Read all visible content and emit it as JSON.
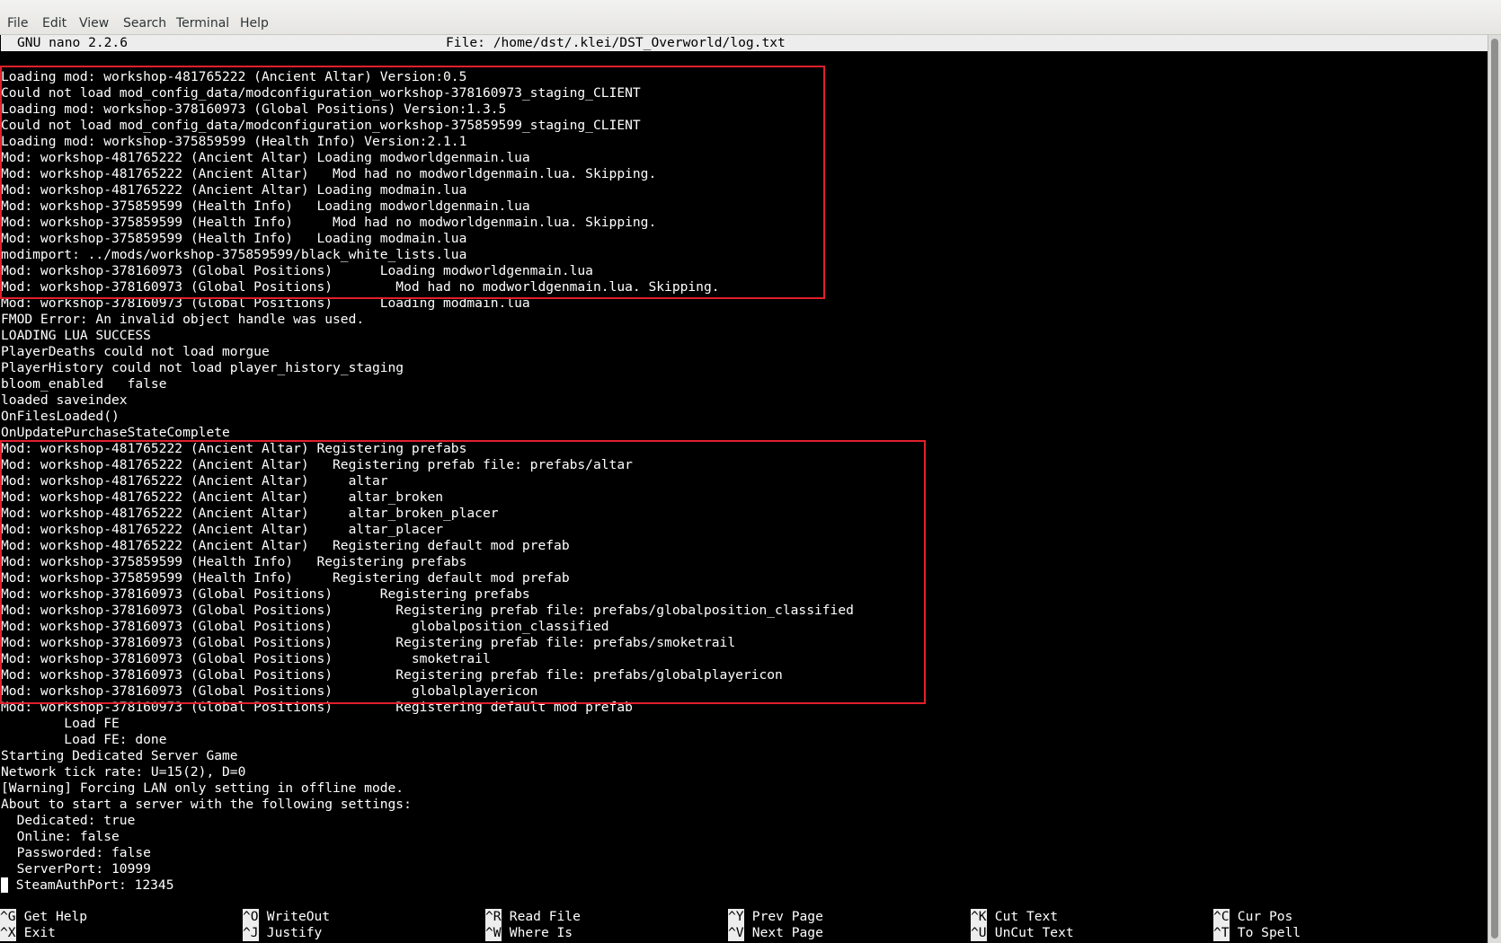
{
  "menu": [
    "File",
    "Edit",
    "View",
    "Search",
    "Terminal",
    "Help"
  ],
  "nano": {
    "version": "GNU nano 2.2.6",
    "file": "File: /home/dst/.klei/DST_Overworld/log.txt"
  },
  "log_lines": [
    "Loading mod: workshop-481765222 (Ancient Altar) Version:0.5",
    "Could not load mod_config_data/modconfiguration_workshop-378160973_staging_CLIENT",
    "Loading mod: workshop-378160973 (Global Positions) Version:1.3.5",
    "Could not load mod_config_data/modconfiguration_workshop-375859599_staging_CLIENT",
    "Loading mod: workshop-375859599 (Health Info) Version:2.1.1",
    "Mod: workshop-481765222 (Ancient Altar) Loading modworldgenmain.lua",
    "Mod: workshop-481765222 (Ancient Altar)   Mod had no modworldgenmain.lua. Skipping.",
    "Mod: workshop-481765222 (Ancient Altar) Loading modmain.lua",
    "Mod: workshop-375859599 (Health Info)   Loading modworldgenmain.lua",
    "Mod: workshop-375859599 (Health Info)     Mod had no modworldgenmain.lua. Skipping.",
    "Mod: workshop-375859599 (Health Info)   Loading modmain.lua",
    "modimport: ../mods/workshop-375859599/black_white_lists.lua",
    "Mod: workshop-378160973 (Global Positions)      Loading modworldgenmain.lua",
    "Mod: workshop-378160973 (Global Positions)        Mod had no modworldgenmain.lua. Skipping.",
    "Mod: workshop-378160973 (Global Positions)      Loading modmain.lua",
    "FMOD Error: An invalid object handle was used.",
    "LOADING LUA SUCCESS",
    "PlayerDeaths could not load morgue",
    "PlayerHistory could not load player_history_staging",
    "bloom_enabled   false",
    "loaded saveindex",
    "OnFilesLoaded()",
    "OnUpdatePurchaseStateComplete",
    "Mod: workshop-481765222 (Ancient Altar) Registering prefabs",
    "Mod: workshop-481765222 (Ancient Altar)   Registering prefab file: prefabs/altar",
    "Mod: workshop-481765222 (Ancient Altar)     altar",
    "Mod: workshop-481765222 (Ancient Altar)     altar_broken",
    "Mod: workshop-481765222 (Ancient Altar)     altar_broken_placer",
    "Mod: workshop-481765222 (Ancient Altar)     altar_placer",
    "Mod: workshop-481765222 (Ancient Altar)   Registering default mod prefab",
    "Mod: workshop-375859599 (Health Info)   Registering prefabs",
    "Mod: workshop-375859599 (Health Info)     Registering default mod prefab",
    "Mod: workshop-378160973 (Global Positions)      Registering prefabs",
    "Mod: workshop-378160973 (Global Positions)        Registering prefab file: prefabs/globalposition_classified",
    "Mod: workshop-378160973 (Global Positions)          globalposition_classified",
    "Mod: workshop-378160973 (Global Positions)        Registering prefab file: prefabs/smoketrail",
    "Mod: workshop-378160973 (Global Positions)          smoketrail",
    "Mod: workshop-378160973 (Global Positions)        Registering prefab file: prefabs/globalplayericon",
    "Mod: workshop-378160973 (Global Positions)          globalplayericon",
    "Mod: workshop-378160973 (Global Positions)        Registering default mod prefab",
    "        Load FE",
    "        Load FE: done",
    "Starting Dedicated Server Game",
    "Network tick rate: U=15(2), D=0",
    "[Warning] Forcing LAN only setting in offline mode.",
    "About to start a server with the following settings:",
    "  Dedicated: true",
    "  Online: false",
    "  Passworded: false",
    "  ServerPort: 10999",
    " SteamAuthPort: 12345"
  ],
  "shortcuts": [
    [
      {
        "key": "^G",
        "label": "Get Help"
      },
      {
        "key": "^X",
        "label": "Exit"
      }
    ],
    [
      {
        "key": "^O",
        "label": "WriteOut"
      },
      {
        "key": "^J",
        "label": "Justify"
      }
    ],
    [
      {
        "key": "^R",
        "label": "Read File"
      },
      {
        "key": "^W",
        "label": "Where Is"
      }
    ],
    [
      {
        "key": "^Y",
        "label": "Prev Page"
      },
      {
        "key": "^V",
        "label": "Next Page"
      }
    ],
    [
      {
        "key": "^K",
        "label": "Cut Text"
      },
      {
        "key": "^U",
        "label": "UnCut Text"
      }
    ],
    [
      {
        "key": "^C",
        "label": "Cur Pos"
      },
      {
        "key": "^T",
        "label": "To Spell"
      }
    ]
  ],
  "colors": {
    "highlight_box": "#e0202c",
    "terminal_bg": "#000000",
    "terminal_fg": "#ffffff",
    "inverse_bg": "#ededed"
  }
}
